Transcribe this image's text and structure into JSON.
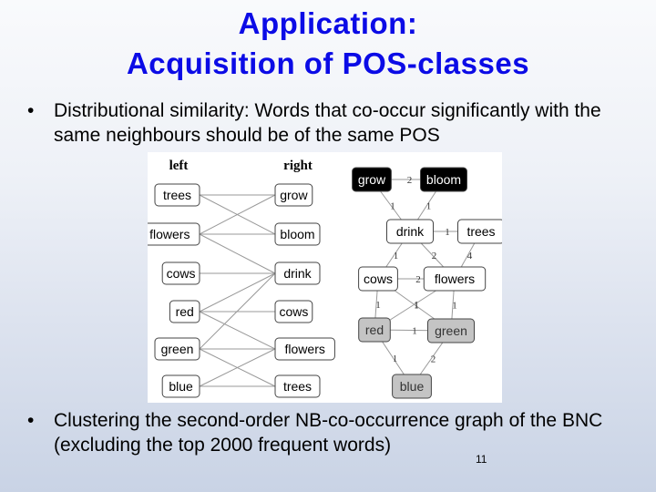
{
  "slide": {
    "title_line1": "Application:",
    "title_line2": "Acquisition of POS-classes",
    "bullets": [
      {
        "symbol": "•",
        "text": "Distributional similarity: Words that co-occur significantly with the same neighbours should be of the same POS"
      },
      {
        "symbol": "•",
        "text": "Clustering the second-order NB-co-occurrence graph of the BNC (excluding the top 2000 frequent words)"
      }
    ],
    "page_number": "11",
    "colors": {
      "title": "#0b0be6",
      "cluster_dark": "#000000",
      "cluster_gray": "#c0c0c0",
      "background_top": "#f9fafc",
      "background_bottom": "#c9d3e5"
    }
  },
  "bipartite_graph": {
    "left_header": "left",
    "right_header": "right",
    "left_nodes": [
      "trees",
      "flowers",
      "cows",
      "red",
      "green",
      "blue"
    ],
    "right_nodes": [
      "grow",
      "bloom",
      "drink",
      "cows",
      "flowers",
      "trees"
    ],
    "edges": [
      [
        "trees",
        "grow"
      ],
      [
        "trees",
        "bloom"
      ],
      [
        "flowers",
        "grow"
      ],
      [
        "flowers",
        "bloom"
      ],
      [
        "flowers",
        "drink"
      ],
      [
        "cows",
        "drink"
      ],
      [
        "red",
        "drink"
      ],
      [
        "red",
        "cows"
      ],
      [
        "red",
        "flowers"
      ],
      [
        "green",
        "drink"
      ],
      [
        "green",
        "flowers"
      ],
      [
        "green",
        "trees"
      ],
      [
        "blue",
        "flowers"
      ],
      [
        "blue",
        "trees"
      ]
    ]
  },
  "cooccurrence_graph": {
    "nodes": [
      {
        "id": "grow",
        "cluster": "dark"
      },
      {
        "id": "bloom",
        "cluster": "dark"
      },
      {
        "id": "drink",
        "cluster": "white"
      },
      {
        "id": "trees",
        "cluster": "white"
      },
      {
        "id": "cows",
        "cluster": "white"
      },
      {
        "id": "flowers",
        "cluster": "white"
      },
      {
        "id": "red",
        "cluster": "gray"
      },
      {
        "id": "green",
        "cluster": "gray"
      },
      {
        "id": "blue",
        "cluster": "gray"
      }
    ],
    "edges": [
      {
        "from": "grow",
        "to": "bloom",
        "weight": "2"
      },
      {
        "from": "grow",
        "to": "drink",
        "weight": "1"
      },
      {
        "from": "bloom",
        "to": "drink",
        "weight": "1"
      },
      {
        "from": "drink",
        "to": "trees",
        "weight": "1"
      },
      {
        "from": "drink",
        "to": "cows",
        "weight": "1"
      },
      {
        "from": "drink",
        "to": "flowers",
        "weight": "2"
      },
      {
        "from": "trees",
        "to": "flowers",
        "weight": "4"
      },
      {
        "from": "cows",
        "to": "flowers",
        "weight": "2"
      },
      {
        "from": "cows",
        "to": "red",
        "weight": "1"
      },
      {
        "from": "cows",
        "to": "green",
        "weight": "1"
      },
      {
        "from": "flowers",
        "to": "red",
        "weight": "1"
      },
      {
        "from": "flowers",
        "to": "green",
        "weight": "1"
      },
      {
        "from": "red",
        "to": "green",
        "weight": "1"
      },
      {
        "from": "red",
        "to": "blue",
        "weight": "1"
      },
      {
        "from": "green",
        "to": "blue",
        "weight": "2"
      }
    ]
  }
}
